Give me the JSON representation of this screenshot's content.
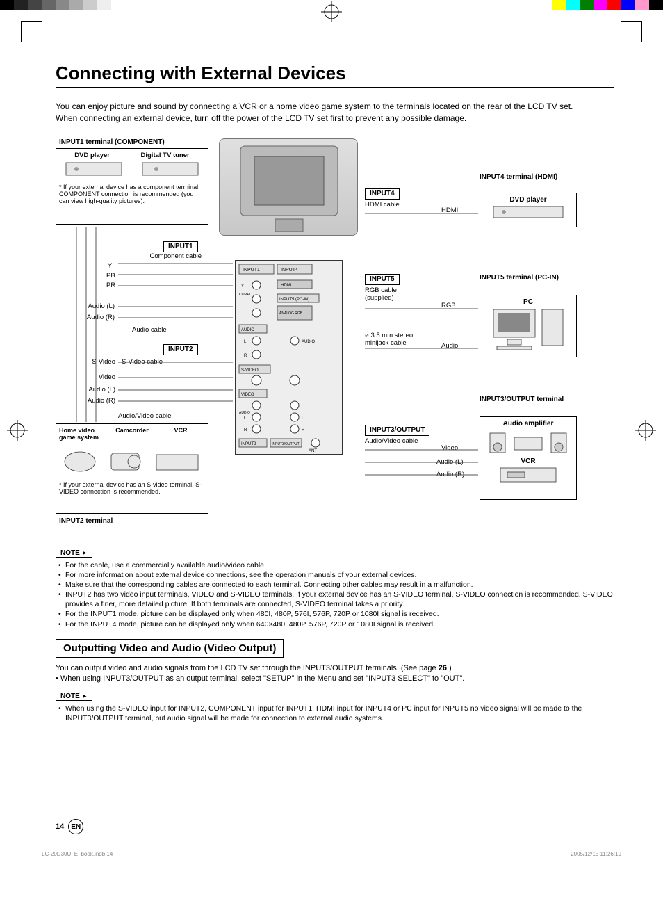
{
  "title": "Connecting with External Devices",
  "intro_line1": "You can enjoy picture and sound by connecting a VCR or a home video game system to the terminals located on the rear of the LCD TV set.",
  "intro_line2": "When connecting an external device, turn off the power of the LCD TV set first to prevent any possible damage.",
  "input1": {
    "header": "INPUT1 terminal (COMPONENT)",
    "dvd": "DVD player",
    "tuner": "Digital TV tuner",
    "note": "If your external device has a component terminal, COMPONENT connection is recommended (you can view high-quality pictures).",
    "tag": "INPUT1",
    "comp_cable": "Component cable",
    "y": "Y",
    "pb": "PB",
    "pr": "PR",
    "audio_l": "Audio (L)",
    "audio_r": "Audio (R)",
    "audio_cable": "Audio cable"
  },
  "input2": {
    "tag": "INPUT2",
    "svideo": "S-Video",
    "svideo_cable": "S-Video cable",
    "video": "Video",
    "audio_l": "Audio (L)",
    "audio_r": "Audio (R)",
    "av_cable": "Audio/Video cable",
    "game": "Home video game system",
    "cam": "Camcorder",
    "vcr": "VCR",
    "note": "If your external device has an S-video terminal, S-VIDEO connection is recommended.",
    "footer": "INPUT2 terminal"
  },
  "input4": {
    "tag": "INPUT4",
    "hdmi_cable": "HDMI cable",
    "hdmi": "HDMI",
    "header": "INPUT4 terminal (HDMI)",
    "dvd": "DVD player"
  },
  "input5": {
    "tag": "INPUT5",
    "rgb_cable": "RGB cable (supplied)",
    "rgb": "RGB",
    "minijack": "ø 3.5 mm stereo minijack cable",
    "audio": "Audio",
    "header": "INPUT5 terminal (PC-IN)",
    "pc": "PC"
  },
  "input3": {
    "tag": "INPUT3/OUTPUT",
    "av_cable": "Audio/Video cable",
    "video": "Video",
    "audio_l": "Audio (L)",
    "audio_r": "Audio (R)",
    "header": "INPUT3/OUTPUT terminal",
    "amp": "Audio amplifier",
    "vcr": "VCR"
  },
  "notes_tag": "NOTE",
  "notes1": [
    "For the cable, use a commercially available audio/video cable.",
    "For more information about external device connections, see the operation manuals of your external devices.",
    "Make sure that the corresponding cables are connected to each terminal. Connecting other cables may result in a malfunction.",
    "INPUT2 has two video input terminals, VIDEO and S-VIDEO terminals. If your external device has an S-VIDEO terminal, S-VIDEO connection is recommended. S-VIDEO provides a finer, more detailed picture. If both terminals are connected, S-VIDEO terminal takes a priority.",
    "For the INPUT1 mode, picture can be displayed only when 480I, 480P, 576I, 576P, 720P or 1080I signal is received.",
    "For the INPUT4 mode, picture can be displayed only when 640×480, 480P, 576P, 720P or 1080I signal is received."
  ],
  "output_title": "Outputting Video and Audio (Video Output)",
  "output_line1a": "You can output video and audio signals from the LCD TV set through the INPUT3/OUTPUT terminals. (See page ",
  "output_line1b": "26",
  "output_line1c": ".)",
  "output_line2": "When using INPUT3/OUTPUT as an output terminal, select \"SETUP\" in the Menu and set \"INPUT3 SELECT\" to \"OUT\".",
  "notes2": [
    "When using the S-VIDEO input for INPUT2, COMPONENT input for INPUT1, HDMI input for INPUT4 or PC input for INPUT5 no video signal will be made to the INPUT3/OUTPUT terminal, but audio signal will be made for connection to external audio systems."
  ],
  "page_num": "14",
  "lang": "EN",
  "print_file": "LC-20D30U_E_book.indb   14",
  "print_date": "2005/12/15   11:26:19"
}
